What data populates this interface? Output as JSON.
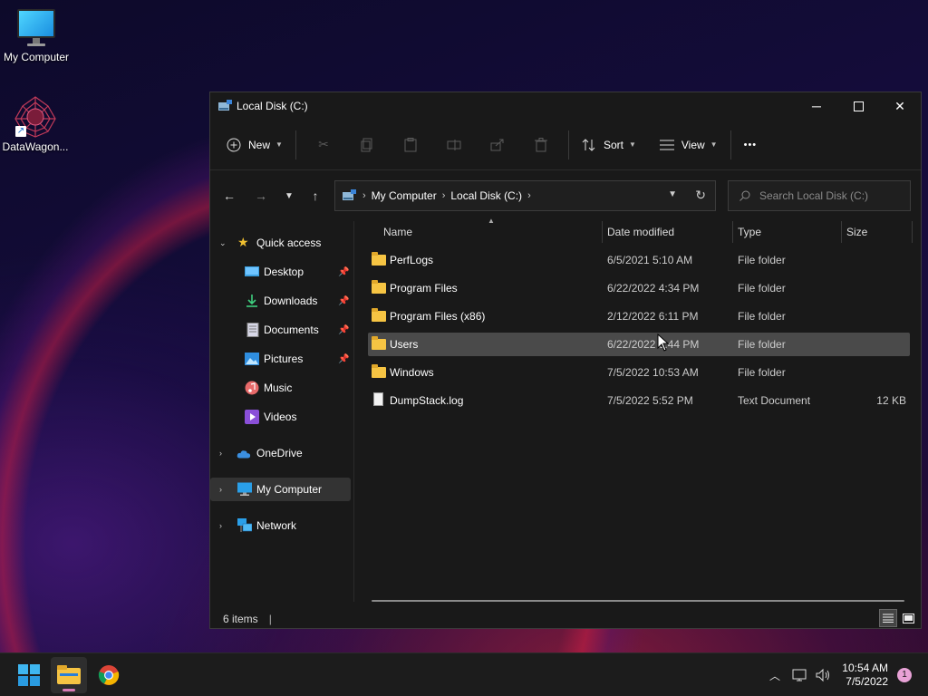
{
  "desktop": {
    "icons": [
      {
        "label": "My Computer",
        "icon": "monitor-icon"
      },
      {
        "label": "DataWagon...",
        "icon": "datawagon-logo-icon"
      }
    ]
  },
  "window": {
    "title": "Local Disk (C:)",
    "controls": {
      "minimize": "─",
      "maximize": "☐",
      "close": "✕"
    },
    "toolbar": {
      "new_label": "New",
      "sort_label": "Sort",
      "view_label": "View",
      "more_label": "•••"
    },
    "address": {
      "crumbs": [
        "My Computer",
        "Local Disk (C:)"
      ],
      "search_placeholder": "Search Local Disk (C:)"
    },
    "nav_pane": {
      "quick_access": "Quick access",
      "items": [
        {
          "label": "Desktop",
          "icon": "desktop-folder-icon",
          "pinned": true
        },
        {
          "label": "Downloads",
          "icon": "download-icon",
          "pinned": true
        },
        {
          "label": "Documents",
          "icon": "documents-icon",
          "pinned": true
        },
        {
          "label": "Pictures",
          "icon": "pictures-icon",
          "pinned": true
        },
        {
          "label": "Music",
          "icon": "music-icon",
          "pinned": false
        },
        {
          "label": "Videos",
          "icon": "videos-icon",
          "pinned": false
        }
      ],
      "onedrive": "OneDrive",
      "my_computer": "My Computer",
      "network": "Network"
    },
    "columns": {
      "name": "Name",
      "date": "Date modified",
      "type": "Type",
      "size": "Size"
    },
    "files": [
      {
        "name": "PerfLogs",
        "date": "6/5/2021 5:10 AM",
        "type": "File folder",
        "size": "",
        "kind": "folder"
      },
      {
        "name": "Program Files",
        "date": "6/22/2022 4:34 PM",
        "type": "File folder",
        "size": "",
        "kind": "folder"
      },
      {
        "name": "Program Files (x86)",
        "date": "2/12/2022 6:11 PM",
        "type": "File folder",
        "size": "",
        "kind": "folder"
      },
      {
        "name": "Users",
        "date": "6/22/2022 3:44 PM",
        "type": "File folder",
        "size": "",
        "kind": "folder"
      },
      {
        "name": "Windows",
        "date": "7/5/2022 10:53 AM",
        "type": "File folder",
        "size": "",
        "kind": "folder"
      },
      {
        "name": "DumpStack.log",
        "date": "7/5/2022 5:52 PM",
        "type": "Text Document",
        "size": "12 KB",
        "kind": "file"
      }
    ],
    "status": {
      "item_count": "6 items",
      "separator": "|"
    }
  },
  "taskbar": {
    "time": "10:54 AM",
    "date": "7/5/2022",
    "notification_count": "1",
    "colors": {
      "accent": "#d87cb7"
    }
  }
}
